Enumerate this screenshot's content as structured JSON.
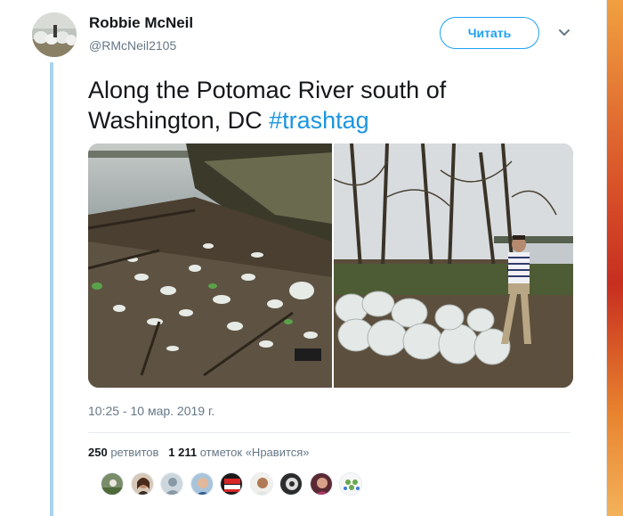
{
  "author": {
    "name": "Robbie McNeil",
    "handle": "@RMcNeil2105",
    "avatar_icon": "avatar-trash-bags"
  },
  "follow_button": {
    "label": "Читать"
  },
  "menu": {
    "icon": "chevron-down-icon"
  },
  "tweet": {
    "text": "Along the Potomac River south of Washington, DC ",
    "hashtag": "#trashtag"
  },
  "media": {
    "photos": [
      {
        "subject": "riverbank-littered-with-plastic-bottles"
      },
      {
        "subject": "man-posing-with-filled-trash-bags"
      }
    ]
  },
  "timestamp": "10:25 - 10 мар. 2019 г.",
  "stats": {
    "retweets_count": "250",
    "retweets_label": "ретвитов",
    "likes_count": "1 211",
    "likes_label": "отметок «Нравится»"
  },
  "likers": [
    {
      "name": "liker-avatar-1"
    },
    {
      "name": "liker-avatar-2"
    },
    {
      "name": "liker-avatar-3"
    },
    {
      "name": "liker-avatar-4"
    },
    {
      "name": "liker-avatar-5"
    },
    {
      "name": "liker-avatar-6"
    },
    {
      "name": "liker-avatar-7"
    },
    {
      "name": "liker-avatar-8"
    },
    {
      "name": "liker-avatar-9"
    }
  ],
  "colors": {
    "accent": "#1da1f2",
    "hashtag": "#1b95e0",
    "secondary_text": "#657786",
    "thread_line": "#a9d3ee"
  }
}
